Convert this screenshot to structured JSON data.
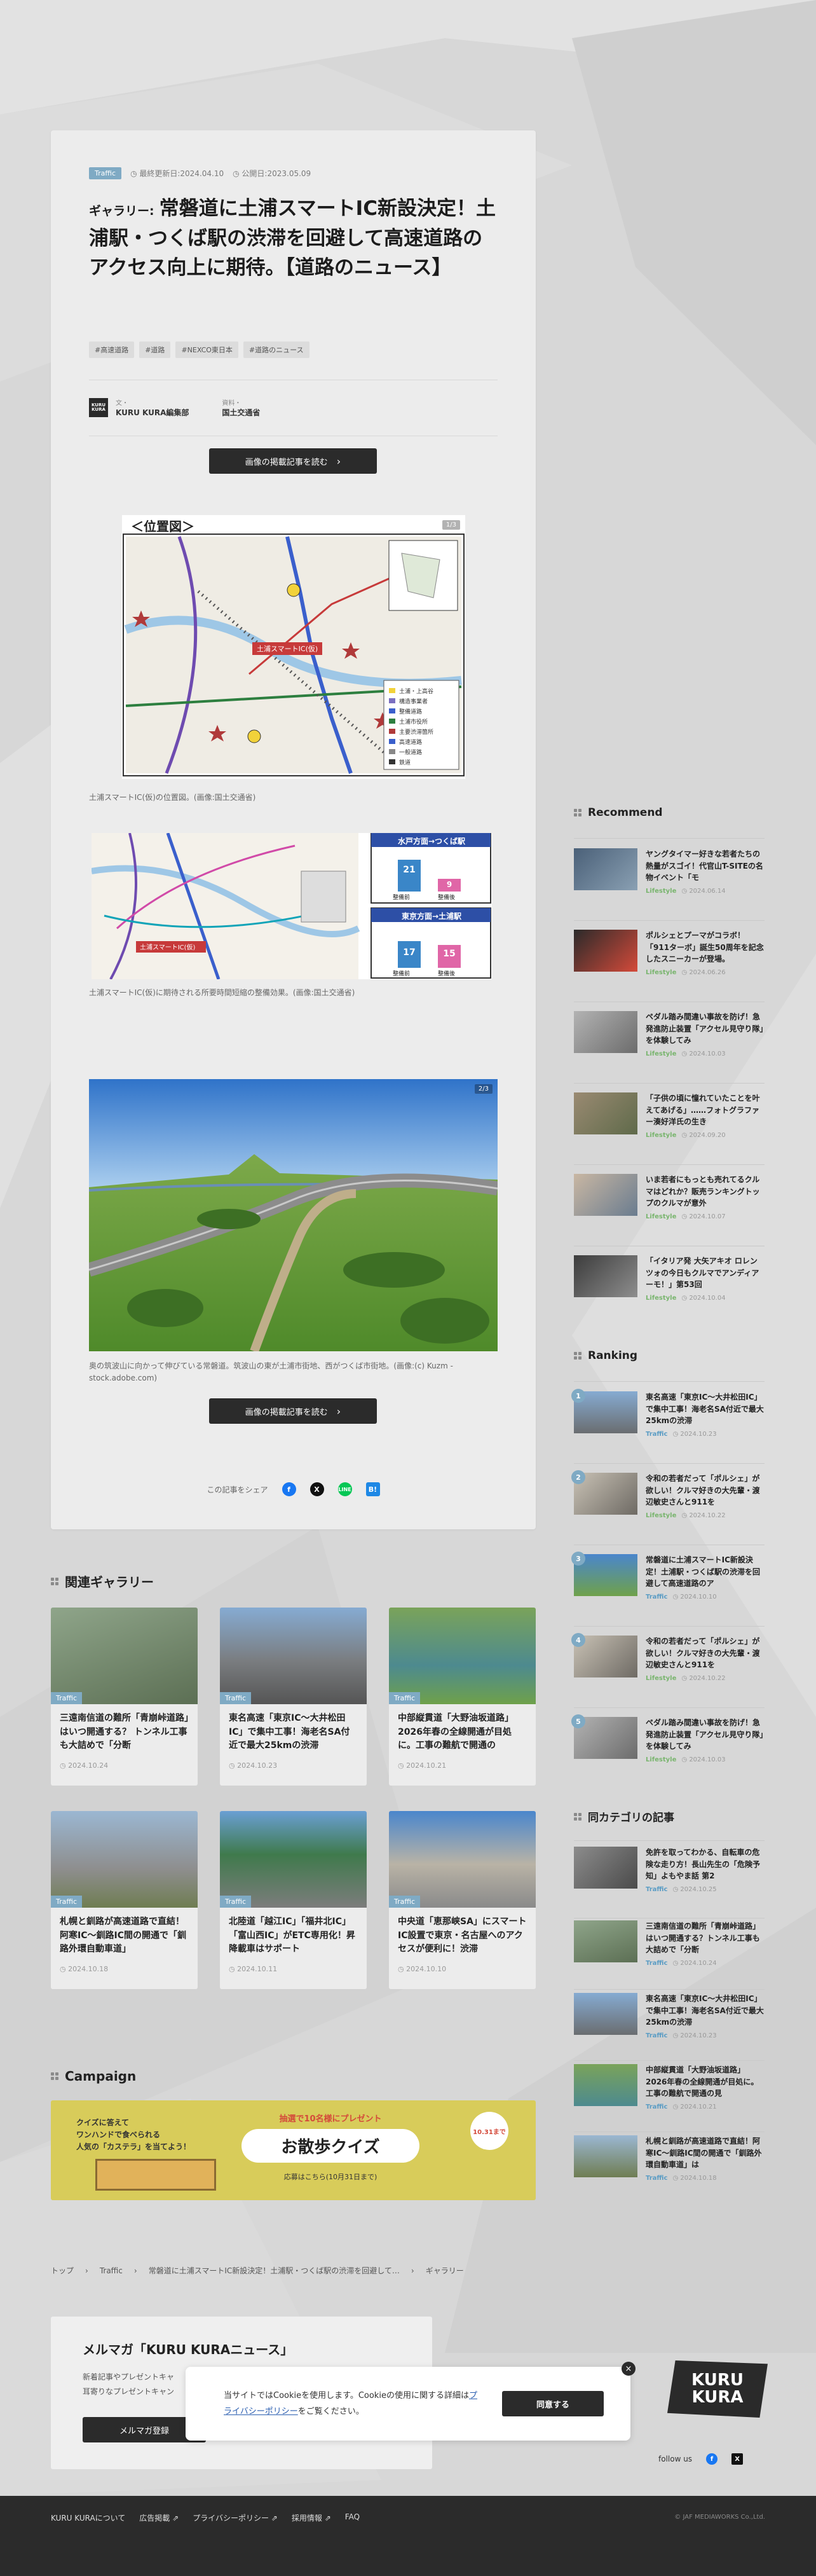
{
  "article": {
    "category": "Traffic",
    "updated": "最終更新日:2024.04.10",
    "published": "公開日:2023.05.09",
    "gallery_label": "ギャラリー:",
    "title": "常磐道に土浦スマートIC新設決定！土浦駅・つくば駅の渋滞を回避して高速道路のアクセス向上に期待。【道路のニュース】",
    "tags": [
      "#高速道路",
      "#道路",
      "#NEXCO東日本",
      "#道路のニュース"
    ],
    "author_label": "文・",
    "author_name": "KURU KURA編集部",
    "source_label": "資料・",
    "source_name": "国土交通省",
    "read_button": "画像の掲載記事を読む",
    "fig1_counter": "1/3",
    "fig1_title": "＜位置図＞",
    "fig1_caption": "土浦スマートIC(仮)の位置図。(画像:国土交通省)",
    "fig2_caption": "土浦スマートIC(仮)に期待される所要時間短縮の整備効果。(画像:国土交通省)",
    "fig2_panel1": "水戸方面→つくば駅",
    "fig2_panel2": "東京方面→土浦駅",
    "fig2_before": "整備前",
    "fig2_after": "整備後",
    "fig2_v1": "21",
    "fig2_v2": "9",
    "fig2_v3": "17",
    "fig2_v4": "15",
    "fig3_counter": "2/3",
    "fig3_caption": "奥の筑波山に向かって伸びている常磐道。筑波山の東が土浦市街地、西がつくば市街地。(画像:(c) Kuzm - stock.adobe.com)",
    "share_label": "この記事をシェア"
  },
  "gallery": {
    "heading": "関連ギャラリー",
    "items": [
      {
        "cat": "Traffic",
        "title": "三遠南信道の難所「青崩峠道路」はいつ開通する？ トンネル工事も大詰めで「分断",
        "date": "2024.10.24"
      },
      {
        "cat": "Traffic",
        "title": "東名高速「東京IC〜大井松田IC」で集中工事！海老名SA付近で最大25kmの渋滞",
        "date": "2024.10.23"
      },
      {
        "cat": "Traffic",
        "title": "中部縦貫道「大野油坂道路」2026年春の全線開通が目処に。工事の難航で開通の",
        "date": "2024.10.21"
      },
      {
        "cat": "Traffic",
        "title": "札幌と釧路が高速道路で直結！阿寒IC〜釧路IC間の開通で「釧路外環自動車道」",
        "date": "2024.10.18"
      },
      {
        "cat": "Traffic",
        "title": "北陸道「越江IC」「福井北IC」「富山西IC」がETC専用化！昇降載車はサポート",
        "date": "2024.10.11"
      },
      {
        "cat": "Traffic",
        "title": "中央道「恵那峡SA」にスマートIC設置で東京・名古屋へのアクセスが便利に！渋滞",
        "date": "2024.10.10"
      }
    ]
  },
  "campaign": {
    "heading": "Campaign",
    "text1": "クイズに答えて",
    "text2": "ワンハンドで食べられる",
    "text3": "人気の「カステラ」を当てよう！",
    "banner_top": "抽選で10名様にプレゼント",
    "banner_main": "お散歩クイズ",
    "deadline": "応募はこちら(10月31日まで)",
    "date_badge": "10.31まで"
  },
  "breadcrumb": [
    "トップ",
    "Traffic",
    "常磐道に土浦スマートIC新設決定！土浦駅・つくば駅の渋滞を回避して…",
    "ギャラリー"
  ],
  "sidebar": {
    "recommend_heading": "Recommend",
    "recommend": [
      {
        "title": "ヤングタイマー好きな若者たちの熱量がスゴイ！代官山T-SITEの名物イベント「モ",
        "cat": "Lifestyle",
        "date": "2024.06.14"
      },
      {
        "title": "ポルシェとプーマがコラボ！「911ターボ」誕生50周年を記念したスニーカーが登場。",
        "cat": "Lifestyle",
        "date": "2024.06.26"
      },
      {
        "title": "ペダル踏み間違い事故を防げ！急発進防止装置「アクセル見守り隊」を体験してみ",
        "cat": "Lifestyle",
        "date": "2024.10.03"
      },
      {
        "title": "「子供の頃に憧れていたことを叶えてあげる」……フォトグラファー湊好洋氏の生き",
        "cat": "Lifestyle",
        "date": "2024.09.20"
      },
      {
        "title": "いま若者にもっとも売れてるクルマはどれか？販売ランキングトップのクルマが意外",
        "cat": "Lifestyle",
        "date": "2024.10.07"
      },
      {
        "title": "「イタリア発 大矢アキオ ロレンツォの今日もクルマでアンディアーモ！」第53回",
        "cat": "Lifestyle",
        "date": "2024.10.04"
      }
    ],
    "ranking_heading": "Ranking",
    "ranking": [
      {
        "rank": "1",
        "title": "東名高速「東京IC〜大井松田IC」で集中工事！海老名SA付近で最大25kmの渋滞",
        "cat": "Traffic",
        "date": "2024.10.23"
      },
      {
        "rank": "2",
        "title": "令和の若者だって「ポルシェ」が欲しい！クルマ好きの大先輩・渡辺敏史さんと911を",
        "cat": "Lifestyle",
        "date": "2024.10.22"
      },
      {
        "rank": "3",
        "title": "常磐道に土浦スマートIC新設決定！土浦駅・つくば駅の渋滞を回避して高速道路のア",
        "cat": "Traffic",
        "date": "2024.10.10"
      },
      {
        "rank": "4",
        "title": "令和の若者だって「ポルシェ」が欲しい！クルマ好きの大先輩・渡辺敏史さんと911を",
        "cat": "Lifestyle",
        "date": "2024.10.22"
      },
      {
        "rank": "5",
        "title": "ペダル踏み間違い事故を防げ！急発進防止装置「アクセル見守り隊」を体験してみ",
        "cat": "Lifestyle",
        "date": "2024.10.03"
      }
    ],
    "same_heading": "同カテゴリの記事",
    "same": [
      {
        "title": "免許を取ってわかる、自転車の危険な走り方！長山先生の「危険予知」よもやま話 第2",
        "cat": "Traffic",
        "date": "2024.10.25"
      },
      {
        "title": "三遠南信道の難所「青崩峠道路」はいつ開通する？トンネル工事も大詰めで「分断",
        "cat": "Traffic",
        "date": "2024.10.24"
      },
      {
        "title": "東名高速「東京IC〜大井松田IC」で集中工事！海老名SA付近で最大25kmの渋滞",
        "cat": "Traffic",
        "date": "2024.10.23"
      },
      {
        "title": "中部縦貫道「大野油坂道路」2026年春の全線開通が目処に。工事の難航で開通の見",
        "cat": "Traffic",
        "date": "2024.10.21"
      },
      {
        "title": "札幌と釧路が高速道路で直結！阿寒IC〜釧路IC間の開通で「釧路外環自動車道」は",
        "cat": "Traffic",
        "date": "2024.10.18"
      }
    ]
  },
  "newsletter": {
    "title": "メルマガ「KURU KURAニュース」",
    "text1": "新着記事やプレゼントキャ",
    "text2": "耳寄りなプレゼントキャン",
    "button": "メルマガ登録"
  },
  "cookie": {
    "text": "当サイトではCookieを使用します。Cookieの使用に関する詳細は",
    "link": "プライバシーポリシー",
    "text_end": "をご覧ください。",
    "button": "同意する",
    "close": "×"
  },
  "brand": {
    "line1": "KURU",
    "line2": "KURA"
  },
  "follow_label": "follow us",
  "footer": {
    "links": [
      "KURU KURAについて",
      "広告掲載",
      "プライバシーポリシー",
      "採用情報",
      "FAQ"
    ],
    "copyright": "© JAF MEDIAWORKS Co.,Ltd."
  }
}
